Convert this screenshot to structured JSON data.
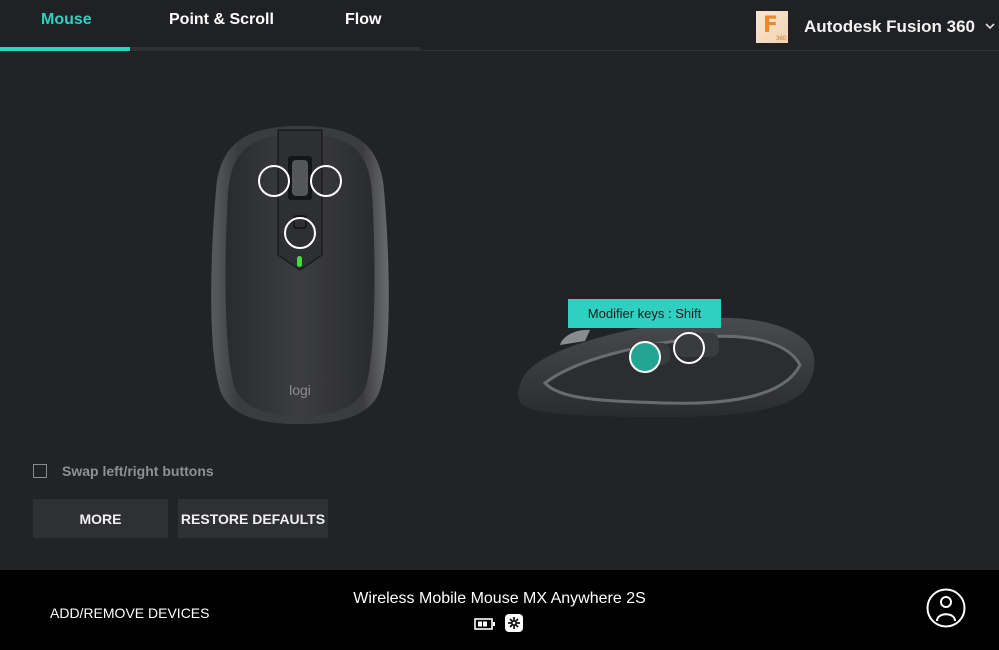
{
  "tabs": [
    {
      "label": "Mouse",
      "active": true
    },
    {
      "label": "Point & Scroll",
      "active": false
    },
    {
      "label": "Flow",
      "active": false
    }
  ],
  "app_selector": {
    "name": "Autodesk Fusion 360",
    "icon_letter": "F",
    "icon_badge": "360",
    "icon": "fusion-360-app-icon",
    "chevron": "chevron-down-icon"
  },
  "colors": {
    "accent": "#2fd0bf",
    "background": "#222326",
    "footer": "#000000",
    "button": "#2f3033"
  },
  "mouse": {
    "top_view_brand": "logi",
    "hotspots_top": [
      "back-button",
      "forward-button",
      "gesture-button"
    ],
    "hotspots_side": [
      "side-button-1",
      "side-button-2"
    ],
    "selected_hotspot": "side-button-1",
    "tooltip": "Modifier keys : Shift"
  },
  "options": {
    "swap_label": "Swap left/right buttons",
    "swap_checked": false
  },
  "buttons": {
    "more": "MORE",
    "restore": "RESTORE DEFAULTS"
  },
  "footer": {
    "add_remove": "ADD/REMOVE DEVICES",
    "device_name": "Wireless Mobile Mouse MX Anywhere 2S",
    "battery_icon": "battery-icon",
    "connection_icon": "unifying-receiver-icon",
    "profile_icon": "user-profile-icon"
  }
}
